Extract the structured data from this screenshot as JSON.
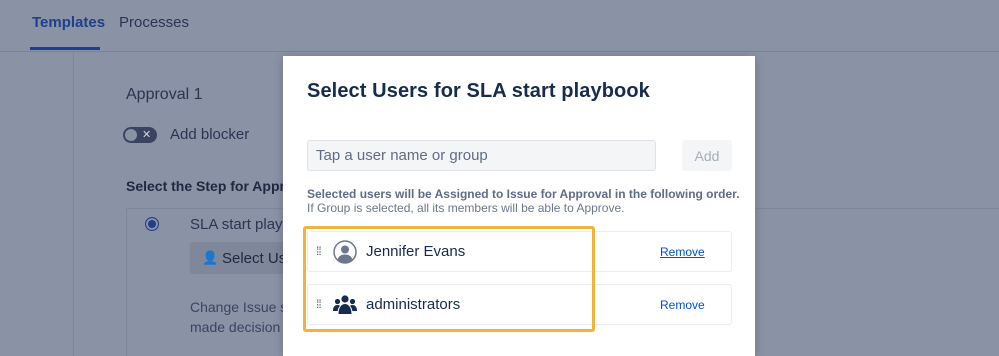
{
  "tabs": [
    {
      "label": "Templates",
      "active": true
    },
    {
      "label": "Processes",
      "active": false
    }
  ],
  "background": {
    "approval_title": "Approval 1",
    "blocker_label": "Add blocker",
    "step_title": "Select the Step for Appro",
    "step_name": "SLA start playb",
    "select_users_label": "Select Us",
    "change_text_line1": "Change Issue s",
    "change_text_line2": "made decision"
  },
  "modal": {
    "title": "Select Users for SLA start playbook",
    "search": {
      "placeholder": "Tap a user name or group",
      "value": ""
    },
    "add_label": "Add",
    "info_line1": "Selected users will be Assigned to Issue for Approval in the following order.",
    "info_line2": "If Group is selected, all its members will be able to Approve.",
    "users": [
      {
        "name": "Jennifer Evans",
        "type": "user",
        "icon": "user-avatar-icon",
        "remove_label": "Remove"
      },
      {
        "name": "administrators",
        "type": "group",
        "icon": "group-icon",
        "remove_label": "Remove"
      }
    ]
  },
  "colors": {
    "accent": "#0052cc",
    "highlight": "#f0b43a",
    "overlay": "#8a92a6"
  }
}
